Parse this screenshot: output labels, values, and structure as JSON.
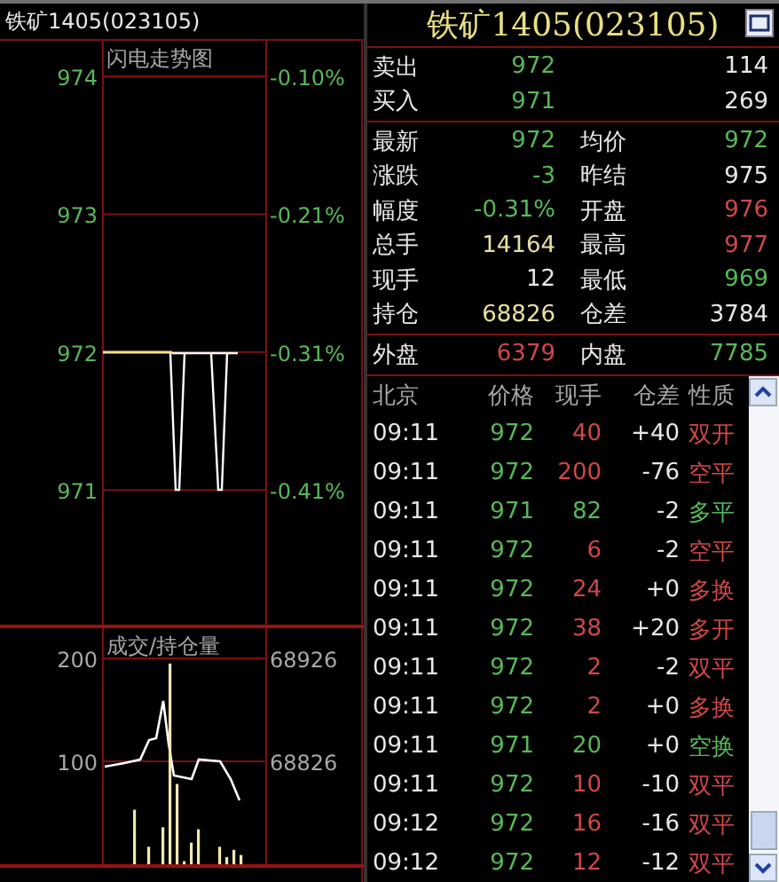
{
  "left_title": "铁矿1405(023105)",
  "price_panel": {
    "title": "闪电走势图",
    "price_labels": [
      "974",
      "973",
      "972",
      "971"
    ],
    "pct_labels": [
      "-0.10%",
      "-0.21%",
      "-0.31%",
      "-0.41%"
    ]
  },
  "volume_panel": {
    "title": "成交/持仓量",
    "volume_labels": [
      "200",
      "100"
    ],
    "oi_labels": [
      "68926",
      "68826"
    ]
  },
  "title": "铁矿1405(023105)",
  "book": [
    {
      "label": "卖出",
      "value": "972",
      "color": "#58b858",
      "right": {
        "value": "114",
        "color": "#e8e8e8"
      }
    },
    {
      "label": "买入",
      "value": "971",
      "color": "#58b858",
      "right": {
        "value": "269",
        "color": "#e8e8e8"
      }
    }
  ],
  "stats": [
    {
      "label": "最新",
      "value": "972",
      "color": "#58b858",
      "right": {
        "label": "均价",
        "value": "972",
        "color": "#58b858"
      }
    },
    {
      "label": "涨跌",
      "value": "-3",
      "color": "#58b858",
      "right": {
        "label": "昨结",
        "value": "975",
        "color": "#e8e8e8"
      }
    },
    {
      "label": "幅度",
      "value": "-0.31%",
      "color": "#58b858",
      "right": {
        "label": "开盘",
        "value": "976",
        "color": "#d04848"
      }
    },
    {
      "label": "总手",
      "value": "14164",
      "color": "#e8e0a0",
      "right": {
        "label": "最高",
        "value": "977",
        "color": "#d04848"
      }
    },
    {
      "label": "现手",
      "value": "12",
      "color": "#e8e8e8",
      "right": {
        "label": "最低",
        "value": "969",
        "color": "#58b858"
      }
    },
    {
      "label": "持仓",
      "value": "68826",
      "color": "#e8e0a0",
      "right": {
        "label": "仓差",
        "value": "3784",
        "color": "#e8e8e8"
      }
    }
  ],
  "flow": {
    "label": "外盘",
    "value": "6379",
    "color": "#d04848",
    "right": {
      "label": "内盘",
      "value": "7785",
      "color": "#58b858"
    }
  },
  "trades": {
    "columns": [
      "北京",
      "价格",
      "现手",
      "仓差",
      "性质"
    ],
    "rows": [
      {
        "time": "09:11",
        "price": "972",
        "qty": "40",
        "oi_change": "+40",
        "nature": "双开",
        "color": "#d04848"
      },
      {
        "time": "09:11",
        "price": "972",
        "qty": "200",
        "oi_change": "-76",
        "nature": "空平",
        "color": "#d04848"
      },
      {
        "time": "09:11",
        "price": "971",
        "qty": "82",
        "oi_change": "-2",
        "nature": "多平",
        "color": "#58b858"
      },
      {
        "time": "09:11",
        "price": "972",
        "qty": "6",
        "oi_change": "-2",
        "nature": "空平",
        "color": "#d04848"
      },
      {
        "time": "09:11",
        "price": "972",
        "qty": "24",
        "oi_change": "+0",
        "nature": "多换",
        "color": "#d04848"
      },
      {
        "time": "09:11",
        "price": "972",
        "qty": "38",
        "oi_change": "+20",
        "nature": "多开",
        "color": "#d04848"
      },
      {
        "time": "09:11",
        "price": "972",
        "qty": "2",
        "oi_change": "-2",
        "nature": "双平",
        "color": "#d04848"
      },
      {
        "time": "09:11",
        "price": "972",
        "qty": "2",
        "oi_change": "+0",
        "nature": "多换",
        "color": "#d04848"
      },
      {
        "time": "09:11",
        "price": "971",
        "qty": "20",
        "oi_change": "+0",
        "nature": "空换",
        "color": "#58b858"
      },
      {
        "time": "09:11",
        "price": "972",
        "qty": "10",
        "oi_change": "-10",
        "nature": "双平",
        "color": "#d04848"
      },
      {
        "time": "09:12",
        "price": "972",
        "qty": "16",
        "oi_change": "-16",
        "nature": "双平",
        "color": "#d04848"
      },
      {
        "time": "09:12",
        "price": "972",
        "qty": "12",
        "oi_change": "-12",
        "nature": "双平",
        "color": "#d04848"
      }
    ]
  }
}
